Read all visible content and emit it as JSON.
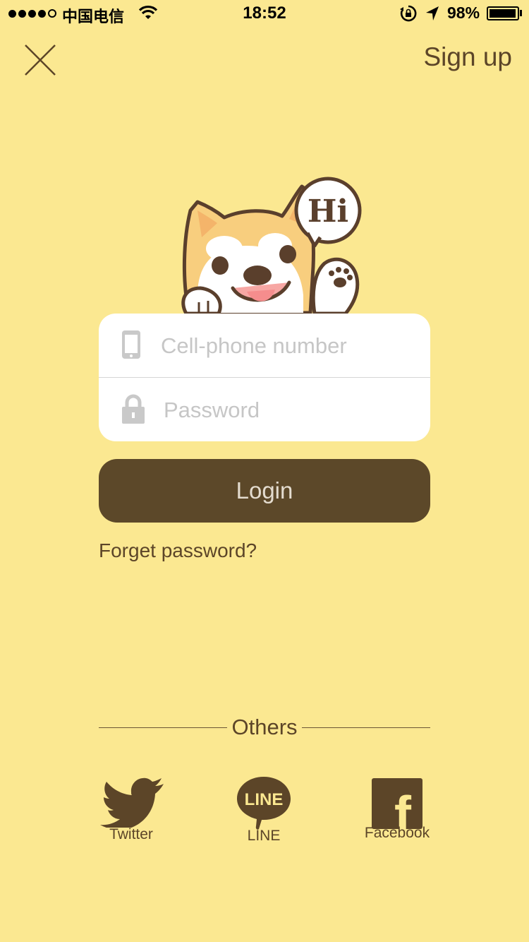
{
  "status_bar": {
    "carrier": "中国电信",
    "time": "18:52",
    "battery": "98%",
    "battery_level": 0.98,
    "signal_bars": 4
  },
  "header": {
    "close_icon": "close-icon",
    "signup_label": "Sign up"
  },
  "mascot": {
    "bubble_text": "Hi"
  },
  "form": {
    "phone_placeholder": "Cell-phone number",
    "phone_value": "",
    "password_placeholder": "Password",
    "password_value": "",
    "phone_icon": "phone-icon",
    "password_icon": "lock-icon"
  },
  "login_label": "Login",
  "forgot_label": "Forget password?",
  "others_label": "Others",
  "social": [
    {
      "label": "Twitter",
      "icon": "twitter-icon"
    },
    {
      "label": "LINE",
      "icon": "line-icon",
      "badge": "LINE"
    },
    {
      "label": "Facebook",
      "icon": "facebook-icon",
      "badge": "f"
    }
  ],
  "colors": {
    "background": "#FBE891",
    "brand_brown": "#5C4829",
    "text_brown": "#5C4528",
    "placeholder": "#C6C6C6"
  }
}
